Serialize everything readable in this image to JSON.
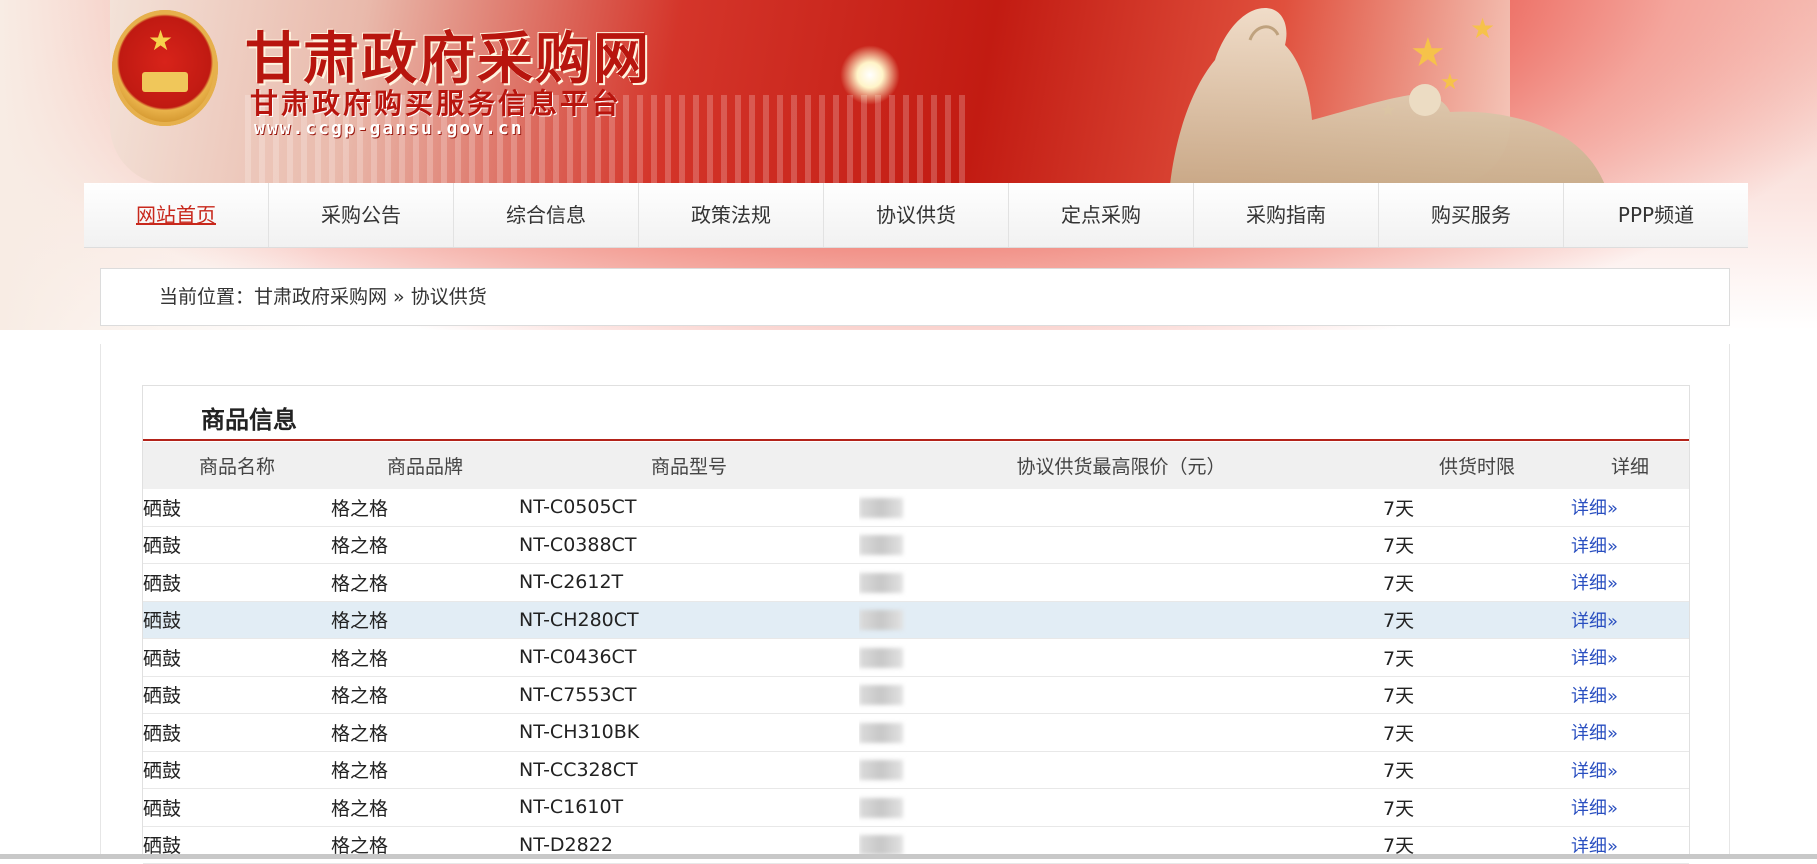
{
  "header": {
    "site_title": "甘肃政府采购网",
    "site_subtitle": "甘肃政府购买服务信息平台",
    "site_url": "www.ccgp-gansu.gov.cn"
  },
  "nav": {
    "items": [
      {
        "label": "网站首页",
        "active": true
      },
      {
        "label": "采购公告"
      },
      {
        "label": "综合信息"
      },
      {
        "label": "政策法规"
      },
      {
        "label": "协议供货"
      },
      {
        "label": "定点采购"
      },
      {
        "label": "采购指南"
      },
      {
        "label": "购买服务"
      },
      {
        "label": "PPP频道"
      }
    ]
  },
  "breadcrumb": {
    "text": "当前位置：甘肃政府采购网 » 协议供货"
  },
  "panel": {
    "title": "商品信息",
    "columns": [
      "商品名称",
      "商品品牌",
      "商品型号",
      "协议供货最高限价（元）",
      "供货时限",
      "详细"
    ],
    "rows": [
      {
        "name": "硒鼓",
        "brand": "格之格",
        "model": "NT-C0505CT",
        "days": "7天",
        "detail": "详细»"
      },
      {
        "name": "硒鼓",
        "brand": "格之格",
        "model": "NT-C0388CT",
        "days": "7天",
        "detail": "详细»"
      },
      {
        "name": "硒鼓",
        "brand": "格之格",
        "model": "NT-C2612T",
        "days": "7天",
        "detail": "详细»"
      },
      {
        "name": "硒鼓",
        "brand": "格之格",
        "model": "NT-CH280CT",
        "days": "7天",
        "detail": "详细»"
      },
      {
        "name": "硒鼓",
        "brand": "格之格",
        "model": "NT-C0436CT",
        "days": "7天",
        "detail": "详细»"
      },
      {
        "name": "硒鼓",
        "brand": "格之格",
        "model": "NT-C7553CT",
        "days": "7天",
        "detail": "详细»"
      },
      {
        "name": "硒鼓",
        "brand": "格之格",
        "model": "NT-CH310BK",
        "days": "7天",
        "detail": "详细»"
      },
      {
        "name": "硒鼓",
        "brand": "格之格",
        "model": "NT-CC328CT",
        "days": "7天",
        "detail": "详细»"
      },
      {
        "name": "硒鼓",
        "brand": "格之格",
        "model": "NT-C1610T",
        "days": "7天",
        "detail": "详细»"
      },
      {
        "name": "硒鼓",
        "brand": "格之格",
        "model": "NT-D2822",
        "days": "7天",
        "detail": "详细»"
      }
    ]
  },
  "colors": {
    "brand_red": "#b8150e",
    "active_nav": "#c8281c",
    "link_blue": "#2a4fc0",
    "rule_red": "#b3231a",
    "highlight_row": "#e2edf5"
  },
  "icons": {
    "emblem": "national-emblem-icon",
    "stars": "star-icon"
  }
}
